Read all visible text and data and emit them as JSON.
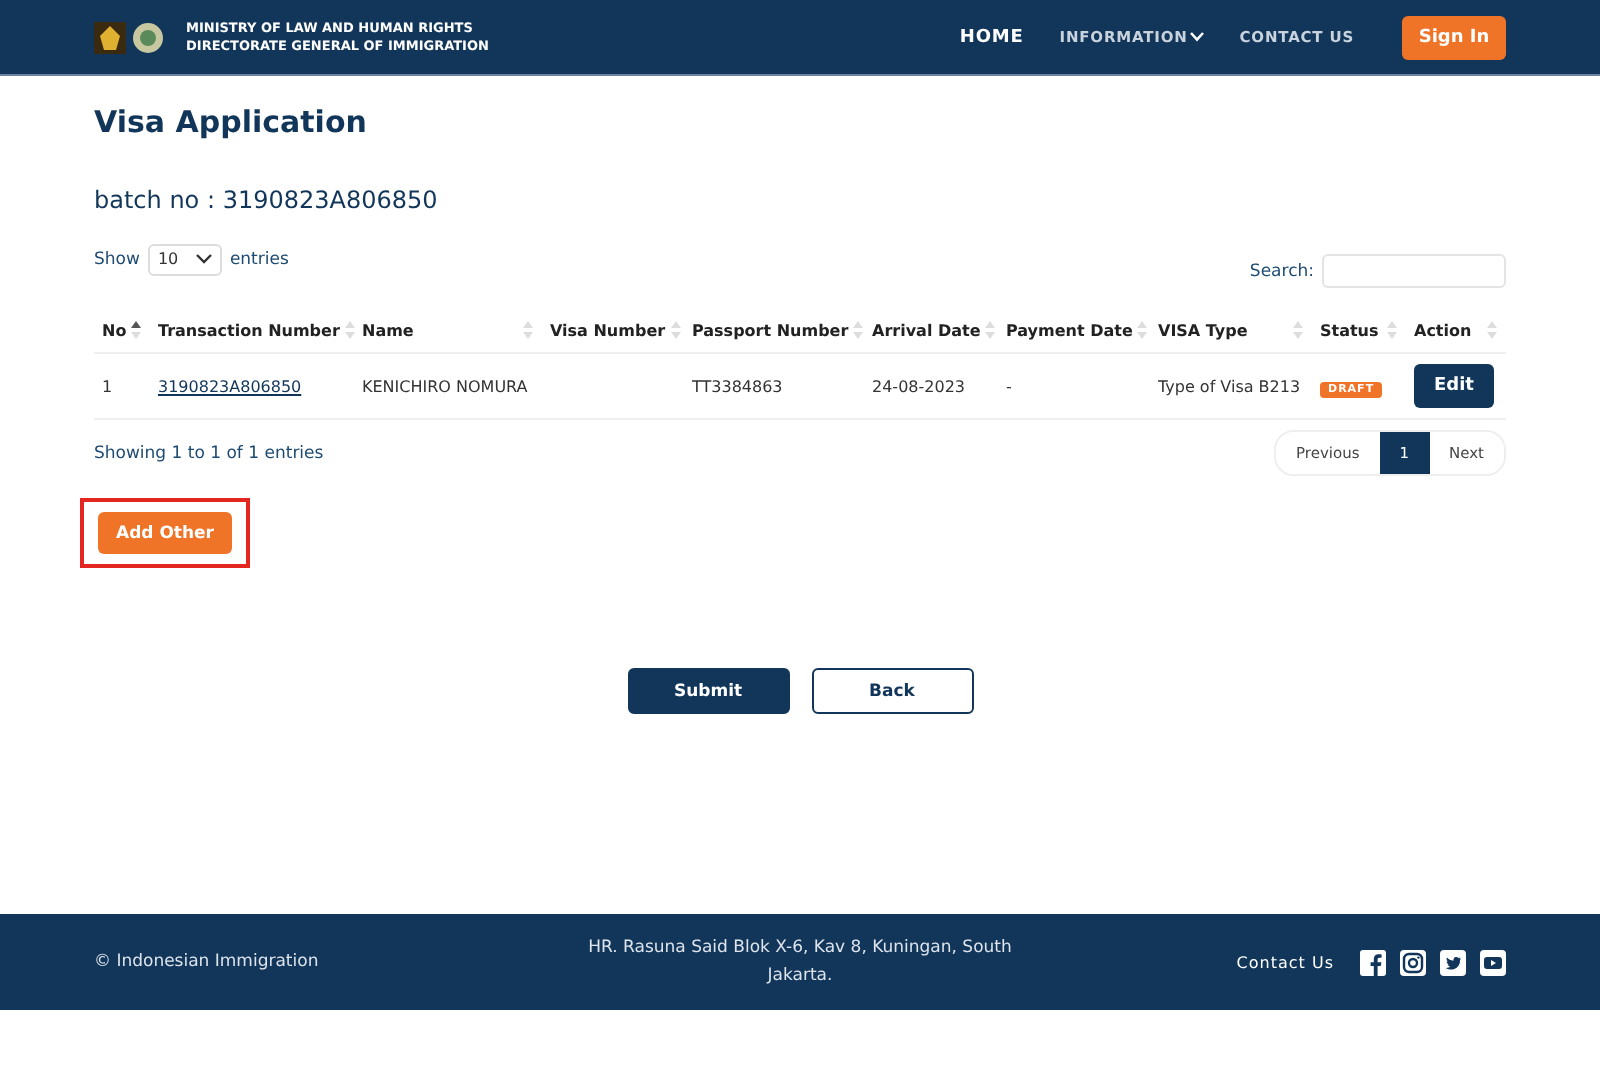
{
  "header": {
    "org_lines": [
      "MINISTRY OF  LAW  AND HUMAN RIGHTS",
      "DIRECTORATE GENERAL OF IMMIGRATION"
    ],
    "nav": [
      {
        "label": "HOME",
        "selected": true,
        "kind": "link"
      },
      {
        "label": "INFORMATION",
        "selected": false,
        "kind": "dropdown"
      },
      {
        "label": "CONTACT US",
        "selected": false,
        "kind": "link"
      }
    ],
    "sign_in": "Sign In"
  },
  "page_title": "Visa Application",
  "batch": "batch no : 3190823A806850",
  "length": {
    "before": "Show",
    "value": "10",
    "after": "entries"
  },
  "search": {
    "label": "Search:"
  },
  "table": {
    "columns": [
      {
        "label": "No",
        "sorted": true
      },
      {
        "label": "Transaction Number",
        "sorted": false
      },
      {
        "label": "Name",
        "sorted": false
      },
      {
        "label": "Visa Number",
        "sorted": false
      },
      {
        "label": "Passport Number",
        "sorted": false
      },
      {
        "label": "Arrival Date",
        "sorted": false
      },
      {
        "label": "Payment Date",
        "sorted": false
      },
      {
        "label": "VISA Type",
        "sorted": false
      },
      {
        "label": "Status",
        "sorted": false
      },
      {
        "label": "Action",
        "sorted": false
      }
    ],
    "rows": [
      {
        "no": "1",
        "transaction": "3190823A806850",
        "name": "KENICHIRO NOMURA",
        "passport": "TT3384863",
        "arrival": "24-08-2023",
        "payment": "-",
        "visa_type": "Type of Visa B213",
        "status": "DRAFT",
        "action": "Edit"
      }
    ]
  },
  "info": "Showing 1 to 1 of 1 entries",
  "pagination": [
    {
      "label": "Previous",
      "selected": false
    },
    {
      "label": "1",
      "selected": true
    },
    {
      "label": "Next",
      "selected": false
    }
  ],
  "add_other": {
    "label": "Add Other",
    "highlighted": true
  },
  "buttons": [
    {
      "label": "Submit",
      "kind": "primary"
    },
    {
      "label": "Back",
      "kind": "outline"
    }
  ],
  "footer": {
    "copyright": "© Indonesian Immigration",
    "address": "HR. Rasuna Said Blok X-6, Kav 8, Kuningan, South Jakarta.",
    "contact": "Contact Us"
  }
}
